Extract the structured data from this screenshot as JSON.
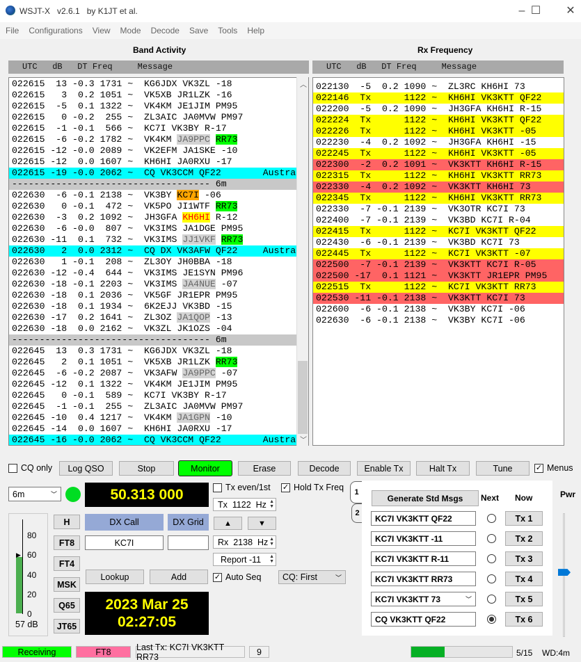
{
  "window": {
    "title": "WSJT-X   v2.6.1   by K1JT et al.",
    "minimize": "–",
    "maximize": "☐",
    "close": "✕"
  },
  "menu": [
    "File",
    "Configurations",
    "View",
    "Mode",
    "Decode",
    "Save",
    "Tools",
    "Help"
  ],
  "band_activity": {
    "title": "Band Activity",
    "header": "UTC   dB   DT Freq     Message",
    "rows": [
      {
        "utc": "022615",
        "db": "13",
        "dt": "-0.3",
        "freq": "1731",
        "msg": [
          [
            "KG6JDX VK3ZL -18",
            ""
          ]
        ]
      },
      {
        "utc": "022615",
        "db": "3",
        "dt": "0.2",
        "freq": "1051",
        "msg": [
          [
            "VK5XB JR1LZK -16",
            ""
          ]
        ]
      },
      {
        "utc": "022615",
        "db": "-5",
        "dt": "0.1",
        "freq": "1322",
        "msg": [
          [
            "VK4KM JE1JIM PM95",
            ""
          ]
        ]
      },
      {
        "utc": "022615",
        "db": "0",
        "dt": "-0.2",
        "freq": "255",
        "msg": [
          [
            "ZL3AIC JA0MVW PM97",
            ""
          ]
        ]
      },
      {
        "utc": "022615",
        "db": "-1",
        "dt": "-0.1",
        "freq": "566",
        "msg": [
          [
            "KC7I VK3BY R-17",
            ""
          ]
        ]
      },
      {
        "utc": "022615",
        "db": "-6",
        "dt": "-0.2",
        "freq": "1782",
        "msg": [
          [
            "VK4KM ",
            ""
          ],
          [
            "JA9PPC",
            "gray"
          ],
          [
            " ",
            ""
          ],
          [
            "RR73",
            "green"
          ]
        ]
      },
      {
        "utc": "022615",
        "db": "-12",
        "dt": "-0.0",
        "freq": "2089",
        "msg": [
          [
            "VK2EFM JA1SKE -10",
            ""
          ]
        ]
      },
      {
        "utc": "022615",
        "db": "-12",
        "dt": "0.0",
        "freq": "1607",
        "msg": [
          [
            "KH6HI JA0RXU -17",
            ""
          ]
        ]
      },
      {
        "utc": "022615",
        "db": "-19",
        "dt": "-0.0",
        "freq": "2062",
        "msg": [
          [
            "CQ VK3CCM QF22",
            ""
          ]
        ],
        "note": "Australi",
        "bg": "cyan"
      },
      {
        "sep": "------------------------------------ 6m"
      },
      {
        "utc": "022630",
        "db": "-6",
        "dt": "-0.1",
        "freq": "2138",
        "msg": [
          [
            "VK3BY ",
            ""
          ],
          [
            "KC7I",
            "orange"
          ],
          [
            " -06",
            ""
          ]
        ]
      },
      {
        "utc": "022630",
        "db": "0",
        "dt": "-0.1",
        "freq": "472",
        "msg": [
          [
            "VK5PO JI1WTF ",
            ""
          ],
          [
            "RR73",
            "green"
          ]
        ]
      },
      {
        "utc": "022630",
        "db": "-3",
        "dt": "0.2",
        "freq": "1092",
        "msg": [
          [
            "JH3GFA ",
            ""
          ],
          [
            "KH6HI",
            "yellow"
          ],
          [
            " R-12",
            ""
          ]
        ]
      },
      {
        "utc": "022630",
        "db": "-6",
        "dt": "-0.0",
        "freq": "807",
        "msg": [
          [
            "VK3IMS JA1DGE PM95",
            ""
          ]
        ]
      },
      {
        "utc": "022630",
        "db": "-11",
        "dt": "0.1",
        "freq": "732",
        "msg": [
          [
            "VK3IMS ",
            ""
          ],
          [
            "JJ1VKF",
            "gray"
          ],
          [
            " ",
            ""
          ],
          [
            "RR73",
            "green"
          ]
        ]
      },
      {
        "utc": "022630",
        "db": "2",
        "dt": "0.0",
        "freq": "2312",
        "msg": [
          [
            "CQ DX VK3AFW QF22",
            ""
          ]
        ],
        "note": "Australi",
        "bg": "cyan"
      },
      {
        "utc": "022630",
        "db": "1",
        "dt": "-0.1",
        "freq": "208",
        "msg": [
          [
            "ZL3OY JH0BBA -18",
            ""
          ]
        ]
      },
      {
        "utc": "022630",
        "db": "-12",
        "dt": "-0.4",
        "freq": "644",
        "msg": [
          [
            "VK3IMS JE1SYN PM96",
            ""
          ]
        ]
      },
      {
        "utc": "022630",
        "db": "-18",
        "dt": "-0.1",
        "freq": "2203",
        "msg": [
          [
            "VK3IMS ",
            ""
          ],
          [
            "JA4NUE",
            "gray"
          ],
          [
            " -07",
            ""
          ]
        ]
      },
      {
        "utc": "022630",
        "db": "-18",
        "dt": "0.1",
        "freq": "2036",
        "msg": [
          [
            "VK5GF JR1EPR PM95",
            ""
          ]
        ]
      },
      {
        "utc": "022630",
        "db": "-18",
        "dt": "0.1",
        "freq": "1934",
        "msg": [
          [
            "6K2EJJ VK3BD -15",
            ""
          ]
        ]
      },
      {
        "utc": "022630",
        "db": "-17",
        "dt": "0.2",
        "freq": "1641",
        "msg": [
          [
            "ZL3OZ ",
            ""
          ],
          [
            "JA1QOP",
            "gray"
          ],
          [
            " -13",
            ""
          ]
        ]
      },
      {
        "utc": "022630",
        "db": "-18",
        "dt": "0.0",
        "freq": "2162",
        "msg": [
          [
            "VK3ZL JK1OZS -04",
            ""
          ]
        ]
      },
      {
        "sep": "------------------------------------ 6m"
      },
      {
        "utc": "022645",
        "db": "13",
        "dt": "0.3",
        "freq": "1731",
        "msg": [
          [
            "KG6JDX VK3ZL -18",
            ""
          ]
        ]
      },
      {
        "utc": "022645",
        "db": "2",
        "dt": "0.1",
        "freq": "1051",
        "msg": [
          [
            "VK5XB JR1LZK ",
            ""
          ],
          [
            "RR73",
            "green"
          ]
        ]
      },
      {
        "utc": "022645",
        "db": "-6",
        "dt": "-0.2",
        "freq": "2087",
        "msg": [
          [
            "VK3AFW ",
            ""
          ],
          [
            "JA9PPC",
            "gray"
          ],
          [
            " -07",
            ""
          ]
        ]
      },
      {
        "utc": "022645",
        "db": "-12",
        "dt": "0.1",
        "freq": "1322",
        "msg": [
          [
            "VK4KM JE1JIM PM95",
            ""
          ]
        ]
      },
      {
        "utc": "022645",
        "db": "0",
        "dt": "-0.1",
        "freq": "589",
        "msg": [
          [
            "KC7I VK3BY R-17",
            ""
          ]
        ]
      },
      {
        "utc": "022645",
        "db": "-1",
        "dt": "-0.1",
        "freq": "255",
        "msg": [
          [
            "ZL3AIC JA0MVW PM97",
            ""
          ]
        ]
      },
      {
        "utc": "022645",
        "db": "-10",
        "dt": "0.4",
        "freq": "1217",
        "msg": [
          [
            "VK4KM ",
            ""
          ],
          [
            "JA1GPN",
            "gray"
          ],
          [
            " -10",
            ""
          ]
        ]
      },
      {
        "utc": "022645",
        "db": "-14",
        "dt": "0.0",
        "freq": "1607",
        "msg": [
          [
            "KH6HI JA0RXU -17",
            ""
          ]
        ]
      },
      {
        "utc": "022645",
        "db": "-16",
        "dt": "-0.0",
        "freq": "2062",
        "msg": [
          [
            "CQ VK3CCM QF22",
            ""
          ]
        ],
        "note": "Australi",
        "bg": "cyan"
      }
    ]
  },
  "rx_frequency": {
    "title": "Rx Frequency",
    "header": "UTC   dB   DT Freq     Message",
    "rows": [
      {
        "utc": "022130",
        "db": "-5",
        "dt": "0.2",
        "freq": "1090",
        "msg": [
          [
            "ZL3RC KH6HI 73",
            ""
          ]
        ]
      },
      {
        "utc": "022146",
        "db": "Tx",
        "dt": "",
        "freq": "1122",
        "msg": [
          [
            "KH6HI VK3KTT QF22",
            ""
          ]
        ],
        "bg": "yellow"
      },
      {
        "utc": "022200",
        "db": "-5",
        "dt": "0.2",
        "freq": "1090",
        "msg": [
          [
            "JH3GFA KH6HI R-15",
            ""
          ]
        ]
      },
      {
        "utc": "022224",
        "db": "Tx",
        "dt": "",
        "freq": "1122",
        "msg": [
          [
            "KH6HI VK3KTT QF22",
            ""
          ]
        ],
        "bg": "yellow"
      },
      {
        "utc": "022226",
        "db": "Tx",
        "dt": "",
        "freq": "1122",
        "msg": [
          [
            "KH6HI VK3KTT -05",
            ""
          ]
        ],
        "bg": "yellow"
      },
      {
        "utc": "022230",
        "db": "-4",
        "dt": "0.2",
        "freq": "1092",
        "msg": [
          [
            "JH3GFA KH6HI -15",
            ""
          ]
        ]
      },
      {
        "utc": "022245",
        "db": "Tx",
        "dt": "",
        "freq": "1122",
        "msg": [
          [
            "KH6HI VK3KTT -05",
            ""
          ]
        ],
        "bg": "yellow"
      },
      {
        "utc": "022300",
        "db": "-2",
        "dt": "0.2",
        "freq": "1091",
        "msg": [
          [
            "VK3KTT KH6HI R-15",
            ""
          ]
        ],
        "bg": "red"
      },
      {
        "utc": "022315",
        "db": "Tx",
        "dt": "",
        "freq": "1122",
        "msg": [
          [
            "KH6HI VK3KTT RR73",
            ""
          ]
        ],
        "bg": "yellow"
      },
      {
        "utc": "022330",
        "db": "-4",
        "dt": "0.2",
        "freq": "1092",
        "msg": [
          [
            "VK3KTT KH6HI 73",
            ""
          ]
        ],
        "bg": "red"
      },
      {
        "utc": "022345",
        "db": "Tx",
        "dt": "",
        "freq": "1122",
        "msg": [
          [
            "KH6HI VK3KTT RR73",
            ""
          ]
        ],
        "bg": "yellow"
      },
      {
        "utc": "022330",
        "db": "-7",
        "dt": "-0.1",
        "freq": "2139",
        "msg": [
          [
            "VK3OTR KC7I 73",
            ""
          ]
        ]
      },
      {
        "utc": "022400",
        "db": "-7",
        "dt": "-0.1",
        "freq": "2139",
        "msg": [
          [
            "VK3BD KC7I R-04",
            ""
          ]
        ]
      },
      {
        "utc": "022415",
        "db": "Tx",
        "dt": "",
        "freq": "1122",
        "msg": [
          [
            "KC7I VK3KTT QF22",
            ""
          ]
        ],
        "bg": "yellow"
      },
      {
        "utc": "022430",
        "db": "-6",
        "dt": "-0.1",
        "freq": "2139",
        "msg": [
          [
            "VK3BD KC7I 73",
            ""
          ]
        ]
      },
      {
        "utc": "022445",
        "db": "Tx",
        "dt": "",
        "freq": "1122",
        "msg": [
          [
            "KC7I VK3KTT -07",
            ""
          ]
        ],
        "bg": "yellow"
      },
      {
        "utc": "022500",
        "db": "-7",
        "dt": "-0.1",
        "freq": "2139",
        "msg": [
          [
            "VK3KTT KC7I R-05",
            ""
          ]
        ],
        "bg": "red"
      },
      {
        "utc": "022500",
        "db": "-17",
        "dt": "0.1",
        "freq": "1121",
        "msg": [
          [
            "VK3KTT JR1EPR PM95",
            ""
          ]
        ],
        "bg": "red"
      },
      {
        "utc": "022515",
        "db": "Tx",
        "dt": "",
        "freq": "1122",
        "msg": [
          [
            "KC7I VK3KTT RR73",
            ""
          ]
        ],
        "bg": "yellow"
      },
      {
        "utc": "022530",
        "db": "-11",
        "dt": "-0.1",
        "freq": "2138",
        "msg": [
          [
            "VK3KTT KC7I 73",
            ""
          ]
        ],
        "bg": "red"
      },
      {
        "utc": "022600",
        "db": "-6",
        "dt": "-0.1",
        "freq": "2138",
        "msg": [
          [
            "VK3BY KC7I -06",
            ""
          ]
        ]
      },
      {
        "utc": "022630",
        "db": "-6",
        "dt": "-0.1",
        "freq": "2138",
        "msg": [
          [
            "VK3BY KC7I -06",
            ""
          ]
        ]
      }
    ]
  },
  "controls": {
    "cq_only": "CQ only",
    "log_qso": "Log QSO",
    "stop": "Stop",
    "monitor": "Monitor",
    "erase": "Erase",
    "decode": "Decode",
    "enable_tx": "Enable Tx",
    "halt_tx": "Halt Tx",
    "tune": "Tune",
    "menus": "Menus",
    "band": "6m",
    "dial_freq": "50.313 000",
    "tx_even": "Tx even/1st",
    "hold_tx_freq": "Hold Tx Freq",
    "tx_freq": "Tx  1122  Hz",
    "rx_freq": "Rx  2138  Hz",
    "report": "Report -11",
    "up": "▲",
    "down": "▼",
    "auto_seq": "Auto Seq",
    "cq_mode": "CQ: First",
    "dx_call_label": "DX Call",
    "dx_grid_label": "DX Grid",
    "dx_call": "KC7I",
    "dx_grid": "",
    "lookup": "Lookup",
    "add": "Add",
    "date": "2023 Mar 25",
    "time": "02:27:05",
    "modes": [
      "H",
      "FT8",
      "FT4",
      "MSK",
      "Q65",
      "JT65"
    ],
    "meter": {
      "ticks": [
        "80",
        "60",
        "40",
        "20",
        "0"
      ],
      "level_db": 57,
      "label": "57 dB"
    }
  },
  "tx_panel": {
    "tabs": [
      "1",
      "2"
    ],
    "generate": "Generate Std Msgs",
    "next": "Next",
    "now": "Now",
    "messages": [
      "KC7I VK3KTT QF22",
      "KC7I VK3KTT -11",
      "KC7I VK3KTT R-11",
      "KC7I VK3KTT RR73",
      "KC7I VK3KTT 73",
      "CQ VK3KTT QF22"
    ],
    "tx_buttons": [
      "Tx 1",
      "Tx 2",
      "Tx 3",
      "Tx 4",
      "Tx 5",
      "Tx 6"
    ],
    "selected_next": 6,
    "pwr": "Pwr",
    "pwr_level_fraction": 0.55
  },
  "statusbar": {
    "state": "Receiving",
    "mode": "FT8",
    "last_tx": "Last Tx: KC7I VK3KTT RR73",
    "count": "9",
    "progress_fraction": 0.33,
    "progress": "5/15",
    "wd": "WD:4m"
  },
  "colors": {
    "monitor": "#00ff00",
    "receiving": "#00ff00",
    "mode": "#ff6fa0",
    "tx_row": "#ffff00",
    "to_me_row": "#ff6464",
    "cq_row": "#00ffff",
    "freq_display": "#ffff00"
  }
}
